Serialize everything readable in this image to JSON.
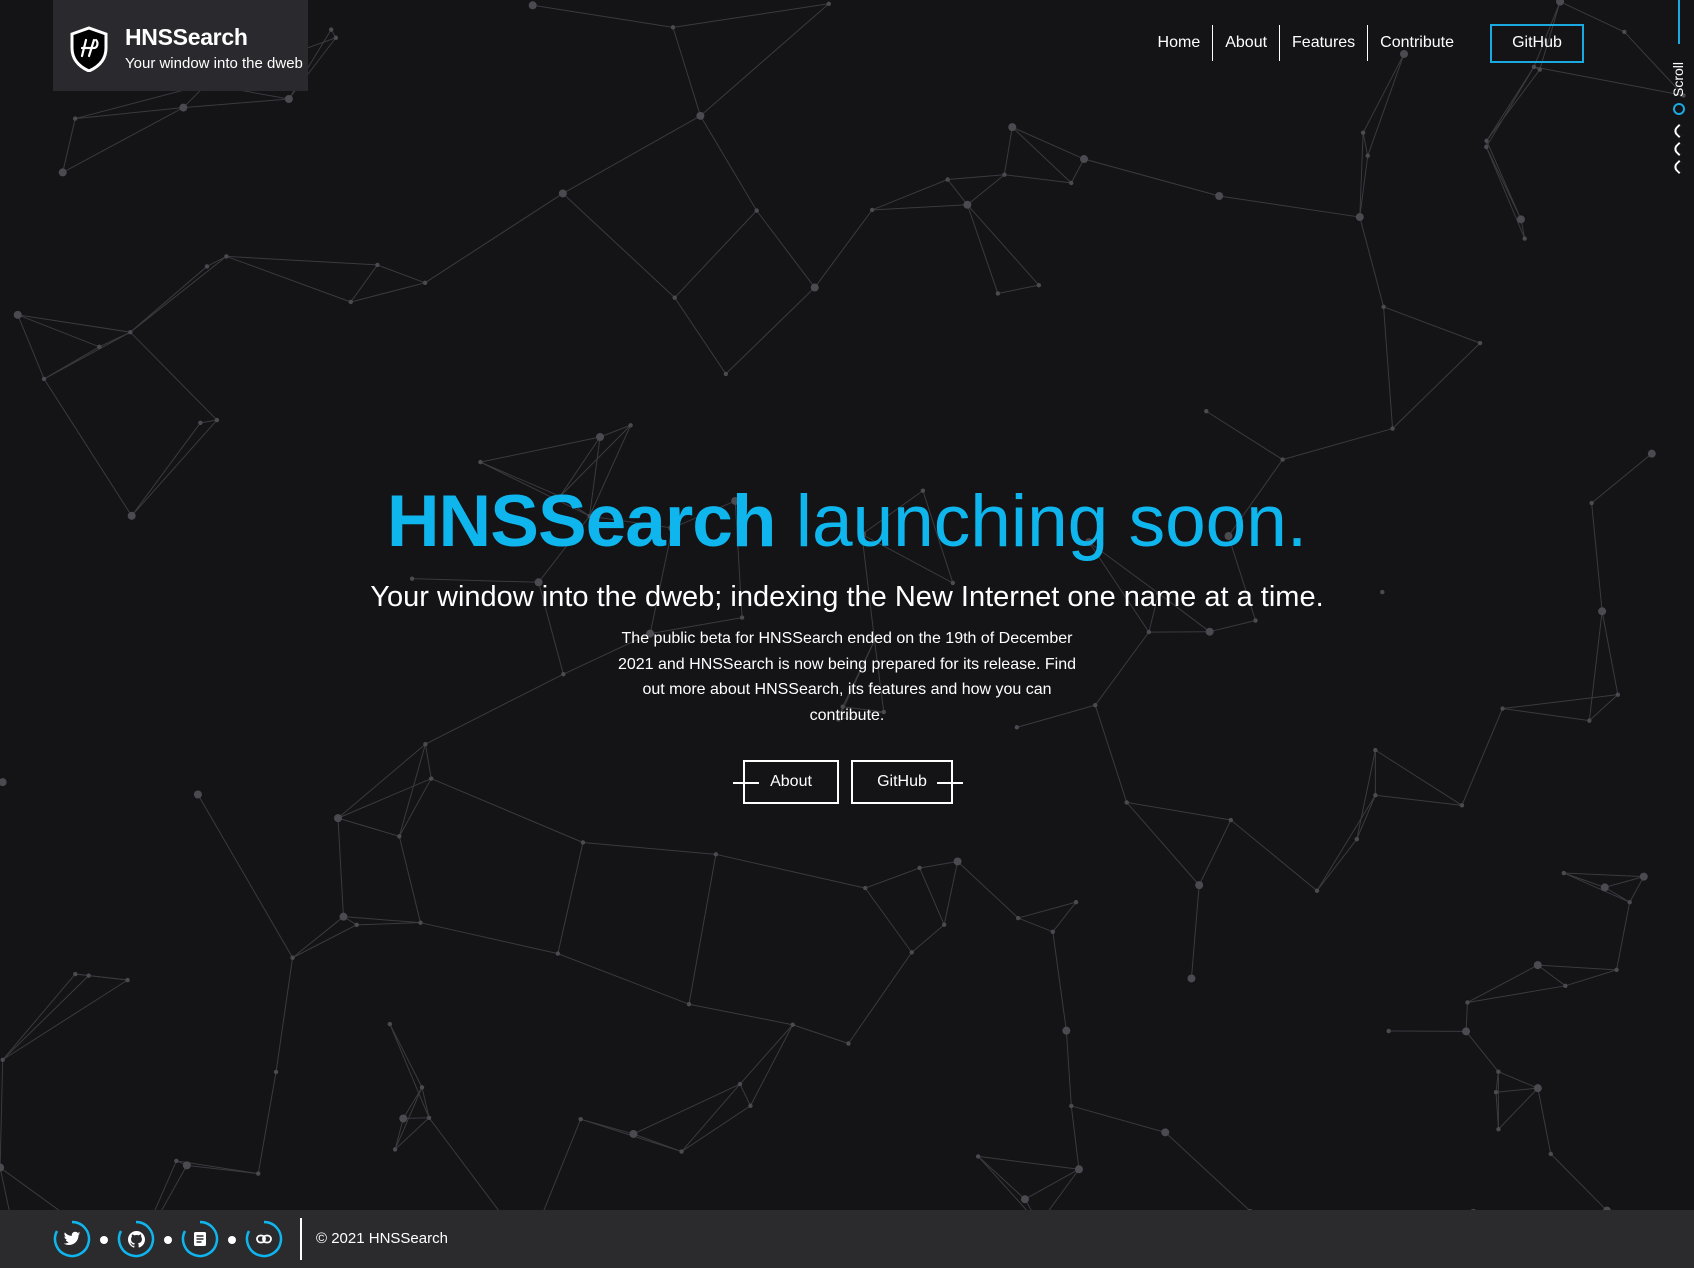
{
  "brand": {
    "title": "HNSSearch",
    "tagline": "Your window into the dweb",
    "logo_icon": "shield-icon"
  },
  "nav": {
    "items": [
      "Home",
      "About",
      "Features",
      "Contribute"
    ],
    "github_label": "GitHub"
  },
  "scroll": {
    "label": "Scroll"
  },
  "hero": {
    "title_strong": "HNSSearch",
    "title_light": "launching soon.",
    "subtitle": "Your window into the dweb; indexing the New Internet one name at a time.",
    "description": "The public beta for HNSSearch ended on the 19th of December 2021 and HNSSearch is now being prepared for its release. Find out more about HNSSearch, its features and how you can contribute.",
    "buttons": [
      "About",
      "GitHub"
    ]
  },
  "footer": {
    "social_icons": [
      "twitter-icon",
      "github-icon",
      "document-icon",
      "link-icon"
    ],
    "copyright": "© 2021 HNSSearch"
  },
  "colors": {
    "accent": "#0fb6ee",
    "background": "#141417",
    "panel": "#2b2b2e"
  }
}
